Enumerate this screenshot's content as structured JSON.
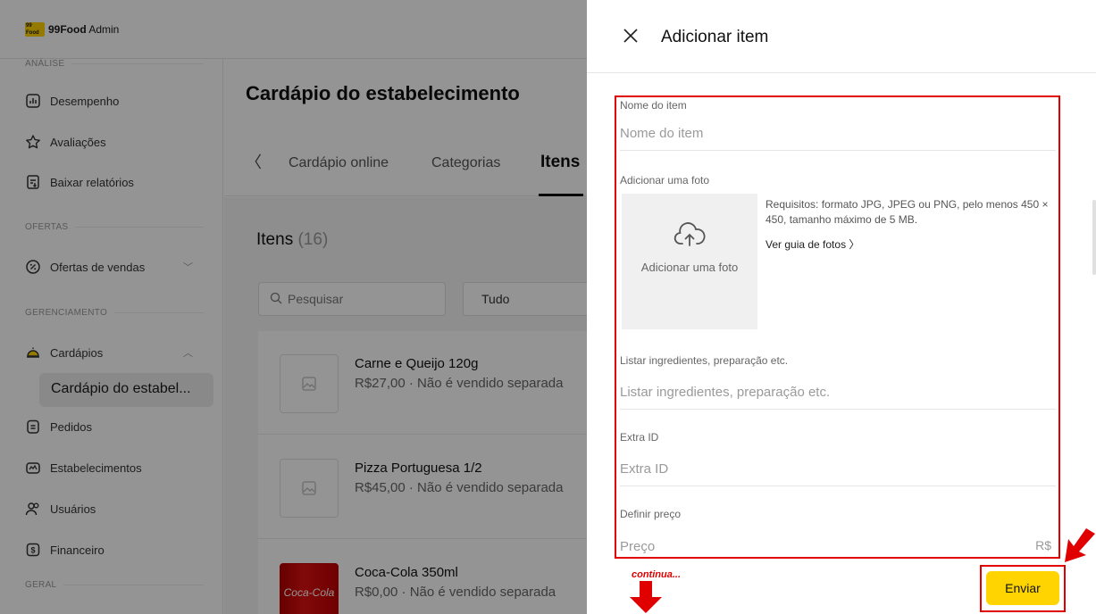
{
  "app": {
    "brand_logo_text": "99 Food",
    "brand_name": "99Food",
    "brand_suffix": "Admin"
  },
  "sidebar": {
    "section_analise": "ANÁLISE",
    "items_analise": [
      {
        "label": "Desempenho",
        "icon": "chart-icon"
      },
      {
        "label": "Avaliações",
        "icon": "star-icon"
      },
      {
        "label": "Baixar relatórios",
        "icon": "download-report-icon"
      }
    ],
    "section_ofertas": "OFERTAS",
    "item_ofertas": {
      "label": "Ofertas de vendas",
      "icon": "percent-icon"
    },
    "section_gerenciamento": "GERENCIAMENTO",
    "item_cardapios": {
      "label": "Cardápios",
      "icon": "cloche-icon"
    },
    "sub_item": "Cardápio do estabel...",
    "items_gerenciamento": [
      {
        "label": "Pedidos",
        "icon": "clipboard-icon"
      },
      {
        "label": "Estabelecimentos",
        "icon": "store-icon"
      },
      {
        "label": "Usuários",
        "icon": "users-icon"
      },
      {
        "label": "Financeiro",
        "icon": "money-icon"
      }
    ],
    "section_geral": "GERAL"
  },
  "main": {
    "title": "Cardápio do estabelecimento",
    "tabs": [
      "Cardápio online",
      "Categorias",
      "Itens"
    ],
    "items_label": "Itens",
    "items_count": "(16)",
    "search_placeholder": "Pesquisar",
    "filter_value": "Tudo",
    "rows": [
      {
        "name": "Carne e Queijo 120g",
        "detail": "R$27,00 · Não é vendido separada"
      },
      {
        "name": "Pizza Portuguesa 1/2",
        "detail": "R$45,00 · Não é vendido separada"
      },
      {
        "name": "Coca-Cola 350ml",
        "detail": "R$0,00 · Não é vendido separada"
      }
    ],
    "can_text": "Coca-Cola"
  },
  "drawer": {
    "title": "Adicionar item",
    "name_label": "Nome do item",
    "name_placeholder": "Nome do item",
    "photo_label": "Adicionar uma foto",
    "photo_button": "Adicionar uma foto",
    "photo_requirements": "Requisitos: formato JPG, JPEG ou PNG, pelo menos 450 × 450, tamanho máximo de 5 MB.",
    "photo_guide": "Ver guia de fotos",
    "desc_label": "Listar ingredientes, preparação etc.",
    "desc_placeholder": "Listar ingredientes, preparação etc.",
    "extra_label": "Extra ID",
    "extra_placeholder": "Extra ID",
    "price_label": "Definir preço",
    "price_placeholder": "Preço",
    "currency": "R$",
    "submit": "Enviar"
  },
  "annotation": {
    "continues": "continua..."
  },
  "colors": {
    "accent": "#ffd400",
    "highlight": "#e00000"
  }
}
